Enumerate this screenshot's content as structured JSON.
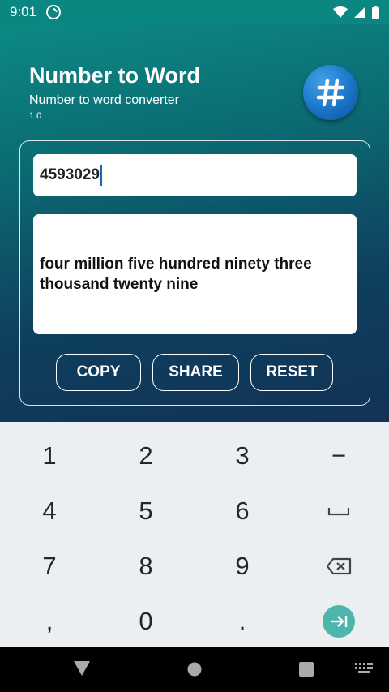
{
  "status_bar": {
    "time": "9:01"
  },
  "app": {
    "title": "Number to Word",
    "subtitle": "Number to word converter",
    "version": "1.0",
    "logo_symbol": "#"
  },
  "converter": {
    "input_value": "4593029",
    "output_line1": "four million five hundred ninety three",
    "output_line2": "thousand twenty nine"
  },
  "buttons": {
    "copy": "COPY",
    "share": "SHARE",
    "reset": "RESET"
  },
  "keyboard": {
    "row1": [
      "1",
      "2",
      "3",
      "−"
    ],
    "row2": [
      "4",
      "5",
      "6"
    ],
    "row3": [
      "7",
      "8",
      "9"
    ],
    "row4": [
      ",",
      "0",
      "."
    ]
  },
  "colors": {
    "accent_teal": "#0a8780",
    "gradient_dark": "#123256",
    "logo_blue": "#1a74c8",
    "tab_key": "#4db6ac"
  }
}
